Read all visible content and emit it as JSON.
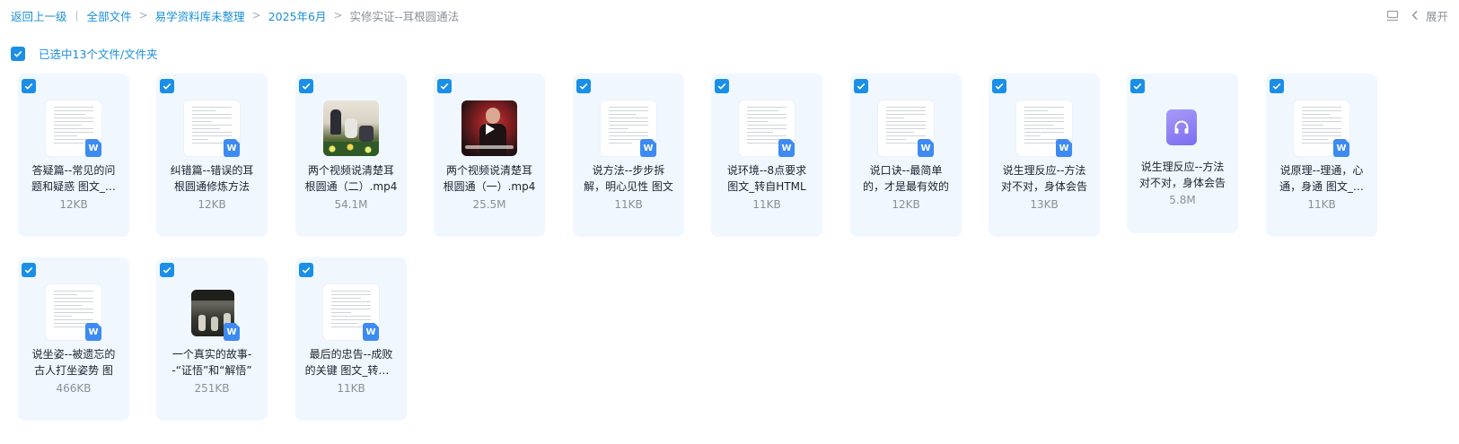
{
  "breadcrumb": {
    "back": "返回上一级",
    "items": [
      "全部文件",
      "易学资料库未整理",
      "2025年6月"
    ],
    "current": "实修实证--耳根圆通法"
  },
  "toolbar": {
    "expand_label": "展开"
  },
  "selection": {
    "label": "已选中13个文件/文件夹"
  },
  "files": [
    {
      "name": "答疑篇--常见的问题和疑惑 图文_转自HTML",
      "size": "12KB",
      "type": "doc",
      "selected": true
    },
    {
      "name": "纠错篇--错误的耳根圆通修炼方法",
      "size": "12KB",
      "type": "doc",
      "selected": true
    },
    {
      "name": "两个视频说清楚耳根圆通（二）.mp4",
      "size": "54.1M",
      "type": "video-1",
      "selected": true
    },
    {
      "name": "两个视频说清楚耳根圆通（一）.mp4",
      "size": "25.5M",
      "type": "video-2",
      "selected": true
    },
    {
      "name": "说方法--步步拆解，明心见性 图文",
      "size": "11KB",
      "type": "doc",
      "selected": true
    },
    {
      "name": "说环境--8点要求 图文_转自HTML",
      "size": "11KB",
      "type": "doc",
      "selected": true
    },
    {
      "name": "说口诀--最简单的，才是最有效的",
      "size": "12KB",
      "type": "doc",
      "selected": true
    },
    {
      "name": "说生理反应--方法对不对，身体会告",
      "size": "13KB",
      "type": "doc",
      "selected": true
    },
    {
      "name": "说生理反应--方法对不对，身体会告",
      "size": "5.8M",
      "type": "audio",
      "selected": true
    },
    {
      "name": "说原理--理通，心通，身通 图文_转自HTML",
      "size": "11KB",
      "type": "doc",
      "selected": true
    },
    {
      "name": "说坐姿--被遗忘的古人打坐姿势 图",
      "size": "466KB",
      "type": "photo",
      "selected": true
    },
    {
      "name": "一个真实的故事--“证悟”和“解悟”",
      "size": "251KB",
      "type": "doc",
      "selected": true
    },
    {
      "name": "最后的忠告--成败的关键 图文_转自HTML",
      "size": "11KB",
      "type": "doc",
      "selected": true
    }
  ],
  "colors": {
    "accent": "#1a8fe8",
    "card_bg": "#f0f7ff",
    "word_badge": "#3d8bf2",
    "audio_tile": "#8f80f5"
  },
  "icons": {
    "checkbox": "check-icon",
    "word_badge": "word-doc-icon",
    "audio": "headphones-icon",
    "video": "play-icon",
    "layout": "layout-icon",
    "expand": "chevron-left-icon"
  }
}
